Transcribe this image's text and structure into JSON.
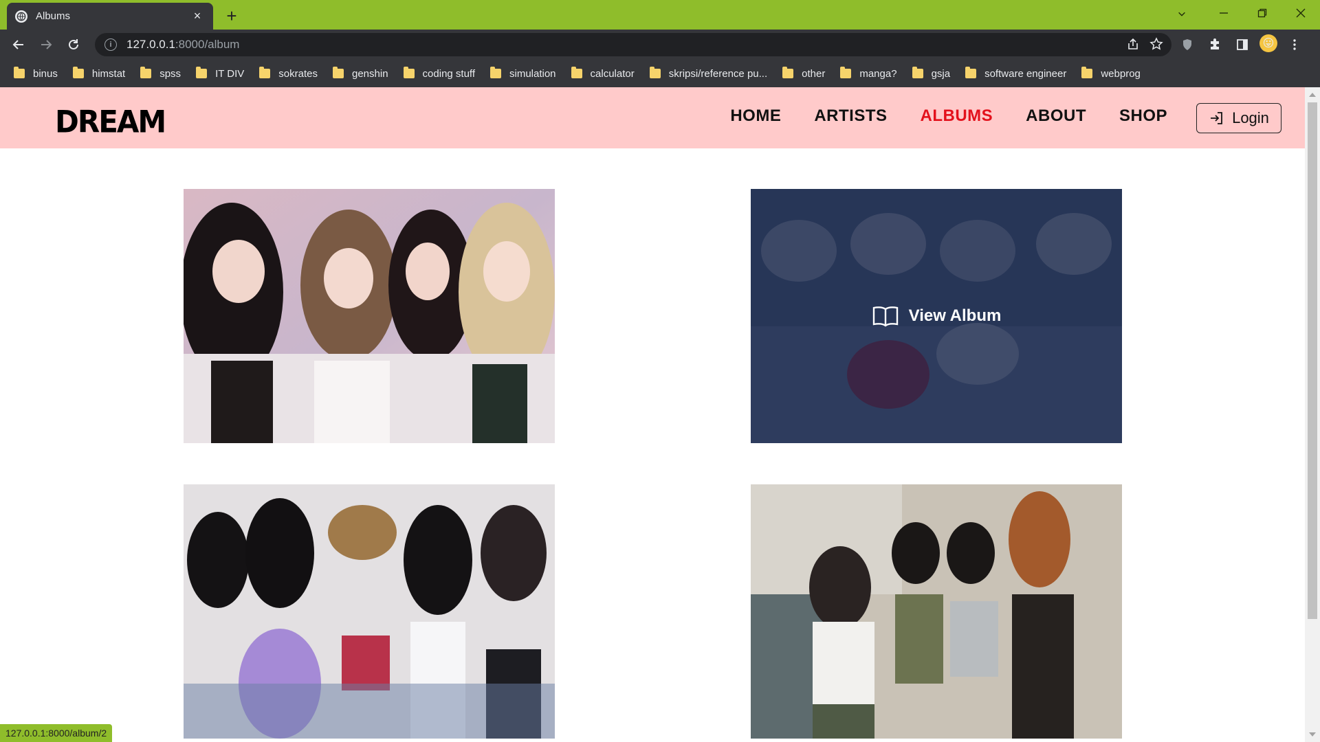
{
  "browser": {
    "tab_title": "Albums",
    "tab_close": "×",
    "new_tab": "+",
    "url_host": "127.0.0.1",
    "url_path": ":8000/album",
    "status_url": "127.0.0.1:8000/album/2",
    "bookmarks": [
      "binus",
      "himstat",
      "spss",
      "IT DIV",
      "sokrates",
      "genshin",
      "coding stuff",
      "simulation",
      "calculator",
      "skripsi/reference pu...",
      "other",
      "manga?",
      "gsja",
      "software engineer",
      "webprog"
    ]
  },
  "site": {
    "logo": "DREAM",
    "nav": [
      "HOME",
      "ARTISTS",
      "ALBUMS",
      "ABOUT",
      "SHOP"
    ],
    "active_nav": "ALBUMS",
    "login_label": "Login"
  },
  "albums": {
    "overlay_label": "View Album",
    "hovered_index": 2
  },
  "colors": {
    "chrome_accent": "#8fbd2b",
    "header_bg": "#ffcaca",
    "active_nav": "#e3111c",
    "overlay": "#142346"
  }
}
